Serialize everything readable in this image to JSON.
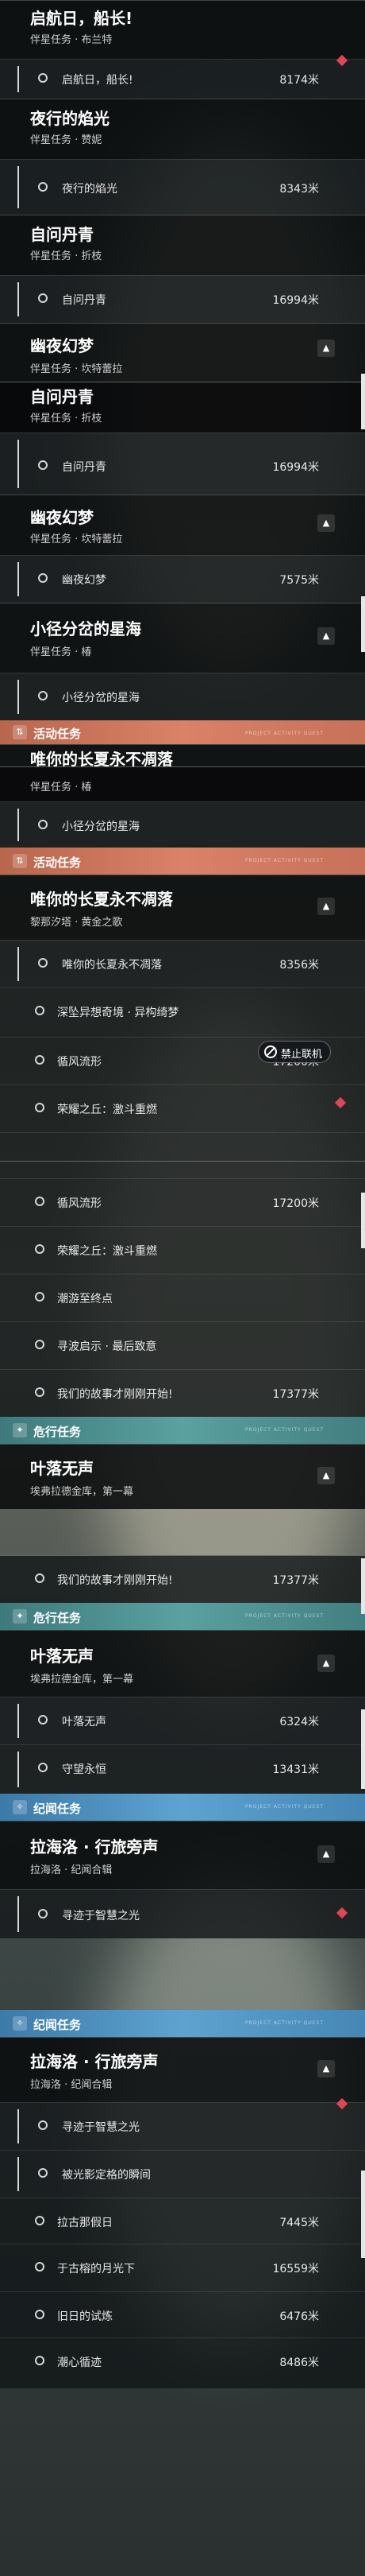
{
  "colors": {
    "action_header": "#c7715a",
    "danger_header": "#4a8d8d",
    "legend_header": "#4a90c2",
    "tracking_marker": "#e04554"
  },
  "sections": {
    "action_label": "活动任务",
    "danger_label": "危行任务",
    "legend_label": "纪闻任务",
    "tag_text": "PROJECT ACTIVITY QUEST"
  },
  "quests": {
    "qihang": {
      "title": "启航日，船长!",
      "subtitle": "伴星任务 · 布兰特",
      "step": "启航日，船长!",
      "distance": "8174米"
    },
    "yexing": {
      "title": "夜行的焰光",
      "subtitle": "伴星任务 · 赞妮",
      "step": "夜行的焰光",
      "distance": "8343米"
    },
    "ziwen": {
      "title": "自问丹青",
      "subtitle": "伴星任务 · 折枝",
      "step": "自问丹青",
      "distance": "16994米"
    },
    "ziwen_alt": {
      "subtitle": "伴星任务 · 折枝"
    },
    "youye": {
      "title": "幽夜幻梦",
      "subtitle": "伴星任务 · 坎特蕾拉",
      "step": "幽夜幻梦",
      "distance": "7575米"
    },
    "xiaojing": {
      "title": "小径分岔的星海",
      "subtitle": "伴星任务 · 椿",
      "step": "小径分岔的星海"
    },
    "weini": {
      "title": "唯你的长夏永不凋落",
      "subtitle": "黎那汐塔 · 黄金之歌",
      "step": "唯你的长夏永不凋落",
      "distance": "8356米"
    },
    "activity_steps": [
      {
        "name": "深坠异想奇境 · 异构绮梦",
        "distance": ""
      },
      {
        "name": "循风流形",
        "distance": "17200米"
      },
      {
        "name": "荣耀之丘：激斗重燃",
        "distance": ""
      },
      {
        "name": "潮游至终点",
        "distance": ""
      },
      {
        "name": "寻波启示 · 最后致意",
        "distance": ""
      },
      {
        "name": "我们的故事才刚刚开始!",
        "distance": "17377米"
      }
    ],
    "yeluo": {
      "title": "叶落无声",
      "subtitle": "埃弗拉德金库，第一幕",
      "steps": [
        {
          "name": "叶落无声",
          "distance": "6324米"
        },
        {
          "name": "守望永恒",
          "distance": "13431米"
        }
      ]
    },
    "lahai": {
      "title": "拉海洛 · 行旅旁声",
      "subtitle": "拉海洛 · 纪闻合辑",
      "steps": [
        {
          "name": "寻迹于智慧之光",
          "distance": ""
        },
        {
          "name": "被光影定格的瞬间",
          "distance": ""
        }
      ]
    },
    "legend_steps": [
      {
        "name": "拉古那假日",
        "distance": "7445米"
      },
      {
        "name": "于古榕的月光下",
        "distance": "16559米"
      },
      {
        "name": "旧日的试炼",
        "distance": "6476米"
      },
      {
        "name": "潮心循迹",
        "distance": "8486米"
      }
    ]
  },
  "overlay": {
    "multiplayer_disabled": "禁止联机"
  }
}
